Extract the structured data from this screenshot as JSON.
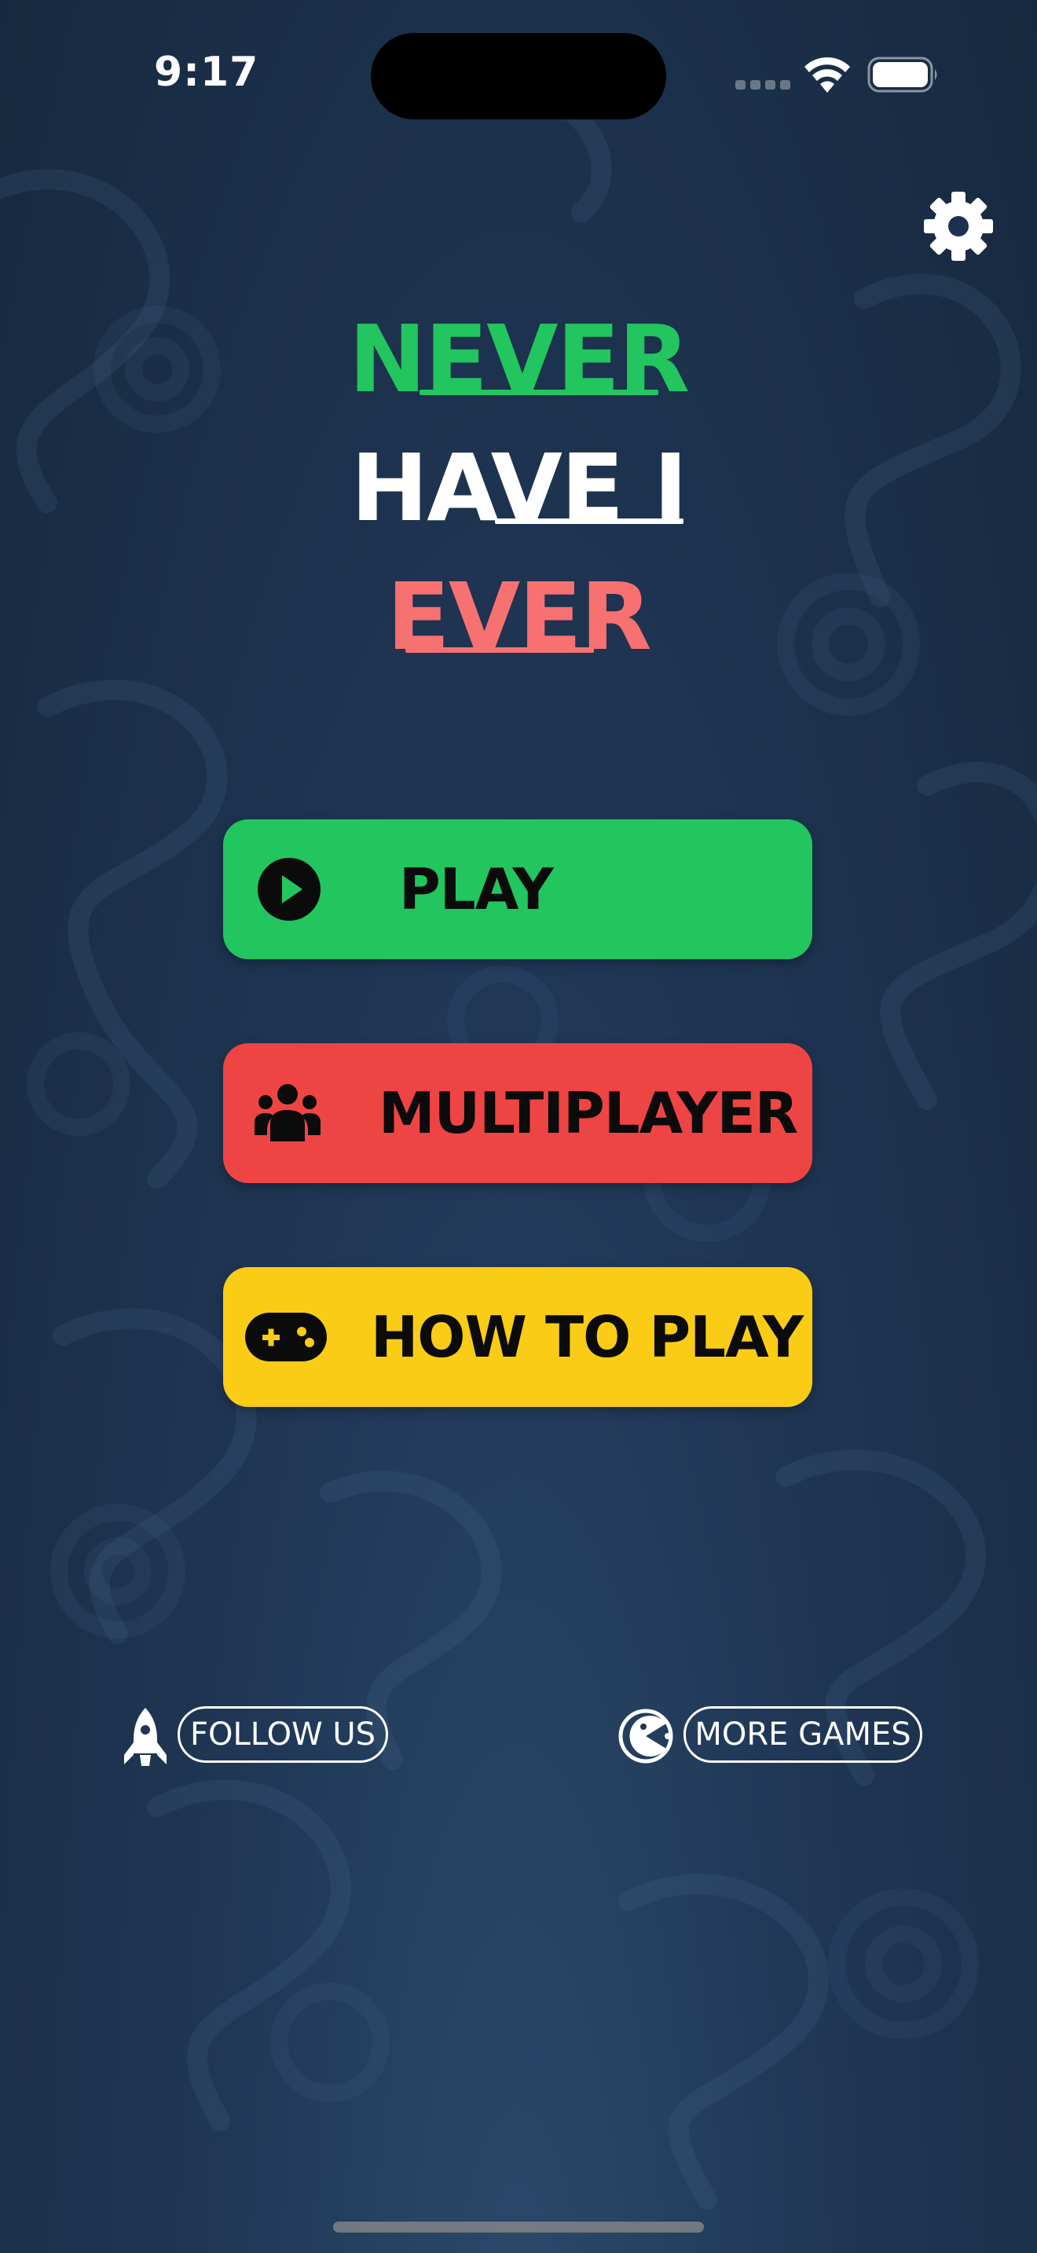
{
  "status_bar": {
    "time": "9:17",
    "signal_icon": "cellular-signal-icon",
    "wifi_icon": "wifi-icon",
    "battery_icon": "battery-icon"
  },
  "header": {
    "settings_icon": "gear-icon"
  },
  "title": {
    "line1": "NEVER",
    "line2": "HAVE I",
    "line3": "EVER",
    "colors": {
      "line1": "#22c55e",
      "line2": "#ffffff",
      "line3": "#f87171"
    }
  },
  "menu": {
    "play": {
      "label": "PLAY",
      "icon": "play-circle-icon",
      "color": "#22c55e"
    },
    "multiplayer": {
      "label": "MULTIPLAYER",
      "icon": "users-icon",
      "color": "#ef4444"
    },
    "how_to_play": {
      "label": "HOW TO PLAY",
      "icon": "gamepad-icon",
      "color": "#facc15"
    }
  },
  "footer": {
    "follow_us": {
      "label": "FOLLOW US",
      "icon": "rocket-icon"
    },
    "more_games": {
      "label": "MORE GAMES",
      "icon": "pacman-icon"
    }
  },
  "background": {
    "base_color": "#1f3654",
    "pattern": "swirl-pattern"
  }
}
